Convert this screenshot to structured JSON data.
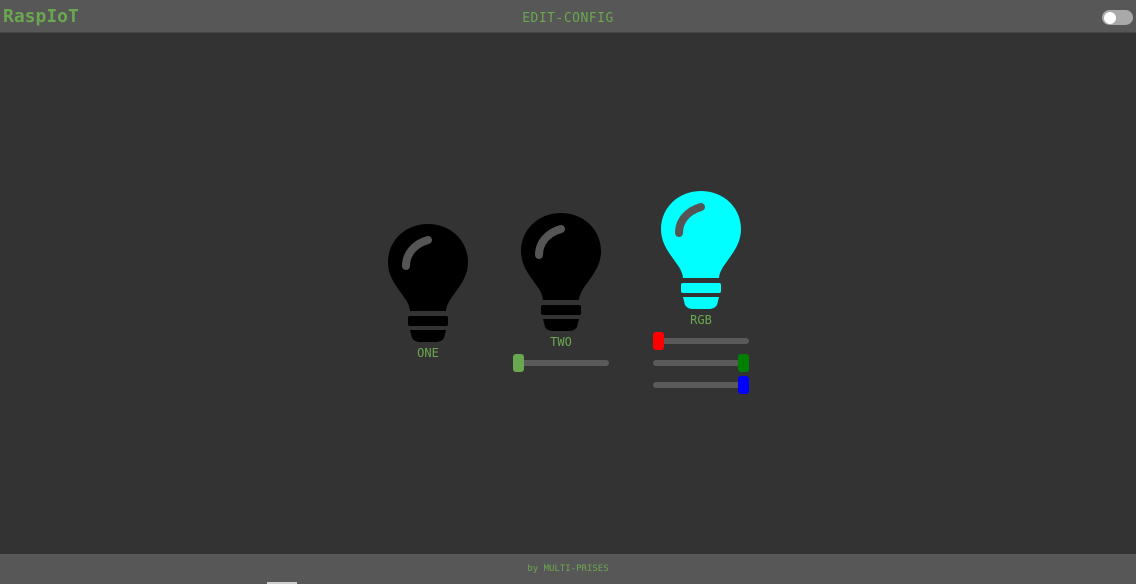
{
  "header": {
    "app_title": "RaspIoT",
    "page_title": "EDIT-CONFIG",
    "mode_toggle_on": false
  },
  "devices": [
    {
      "label": "ONE",
      "color": "#000000",
      "on": false
    },
    {
      "label": "TWO",
      "color": "#000000",
      "on": false,
      "brightness": 0.0,
      "slider_color": "#6aa84f"
    },
    {
      "label": "RGB",
      "color": "#00ffff",
      "on": true,
      "channels": [
        {
          "name": "red",
          "value": 0,
          "color": "#ff0000"
        },
        {
          "name": "green",
          "value": 255,
          "color": "#008000"
        },
        {
          "name": "blue",
          "value": 255,
          "color": "#0000ff"
        }
      ]
    }
  ],
  "footer": {
    "text": "by MULTI-PRISES"
  }
}
